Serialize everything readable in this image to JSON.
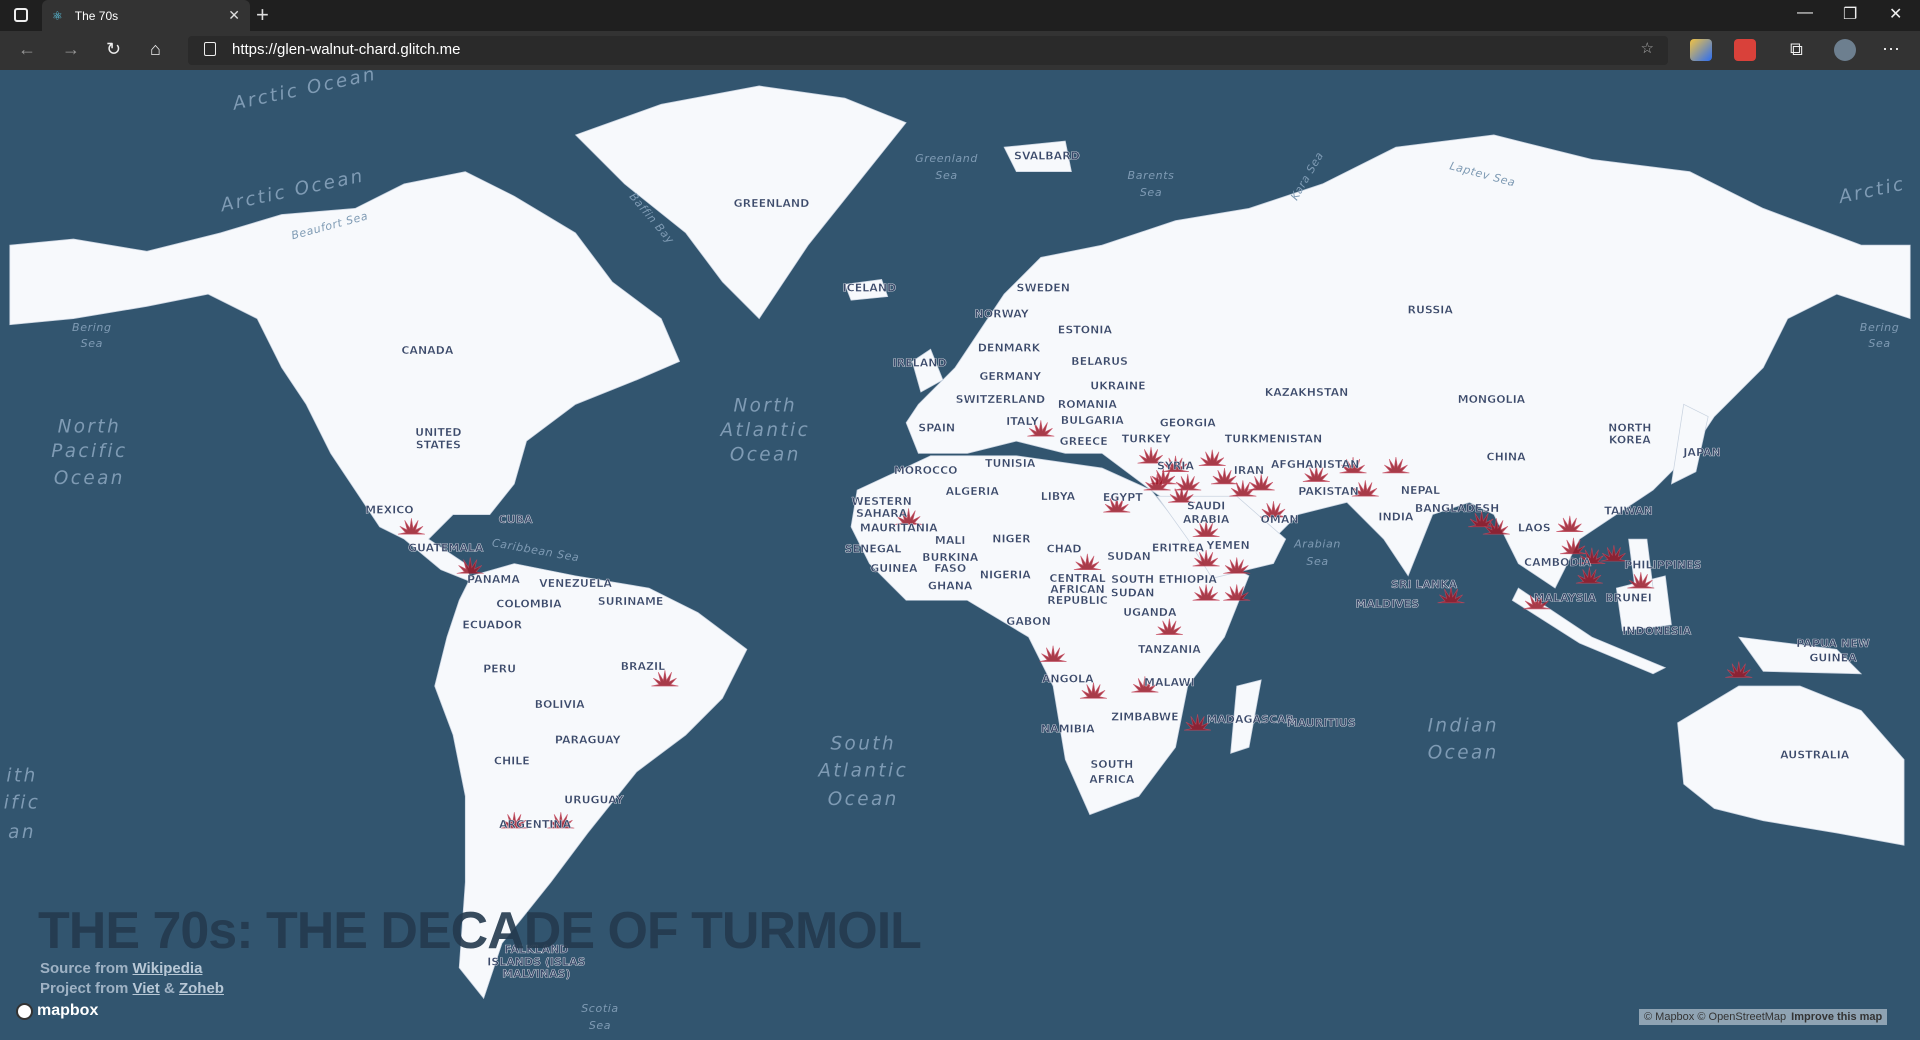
{
  "browser": {
    "tab_title": "The 70s",
    "url": "https://glen-walnut-chard.glitch.me",
    "icons": [
      "sidebar-icon",
      "react-favicon",
      "close-icon",
      "plus-icon",
      "back-icon",
      "forward-icon",
      "refresh-icon",
      "home-icon",
      "lock-icon",
      "favorite-add-icon",
      "extension-icon",
      "extension-icon-2",
      "collections-icon",
      "profile-avatar",
      "more-icon",
      "minimize-icon",
      "restore-icon",
      "window-close-icon"
    ]
  },
  "page": {
    "title": "THE 70s: THE DECADE OF TURMOIL",
    "source_prefix": "Source from ",
    "source_link": "Wikipedia",
    "project_prefix": "Project from ",
    "project_link1": "Viet",
    "project_amp": " & ",
    "project_link2": "Zoheb"
  },
  "map": {
    "colors": {
      "water": "#32556f",
      "land": "#f7f9fc",
      "marker": "#9b1b2a",
      "country_label": "#3b4a6b",
      "ocean_label": "#7f9bb4"
    },
    "oceans": [
      "Arctic Ocean",
      "Arctic Ocean",
      "Arctic",
      "North",
      "Pacific",
      "Ocean",
      "North",
      "Atlantic",
      "Ocean",
      "South",
      "Atlantic",
      "Ocean",
      "Indian",
      "Ocean",
      "ith",
      "ific",
      "an",
      "Greenland",
      "Sea",
      "Barents",
      "Sea",
      "Laptev Sea",
      "Bering",
      "Sea",
      "Bering",
      "Sea",
      "Arabian",
      "Sea",
      "Caribbean Sea",
      "Beaufort Sea",
      "Baffin Bay",
      "Kara Sea",
      "Scotia",
      "Sea"
    ],
    "countries": [
      "GREENLAND",
      "ICELAND",
      "SVALBARD",
      "CANADA",
      "UNITED",
      "STATES",
      "MEXICO",
      "CUBA",
      "GUATEMALA",
      "PANAMA",
      "VENEZUELA",
      "SURINAME",
      "COLOMBIA",
      "ECUADOR",
      "PERU",
      "BRAZIL",
      "BOLIVIA",
      "PARAGUAY",
      "CHILE",
      "URUGUAY",
      "ARGENTINA",
      "FALKLAND",
      "ISLANDS (ISLAS",
      "MALVINAS)",
      "SWEDEN",
      "NORWAY",
      "ESTONIA",
      "DENMARK",
      "IRELAND",
      "GERMANY",
      "BELARUS",
      "UKRAINE",
      "SWITZERLAND",
      "ROMANIA",
      "BULGARIA",
      "SPAIN",
      "ITALY",
      "GREECE",
      "TURKEY",
      "GEORGIA",
      "MOROCCO",
      "TUNISIA",
      "ALGERIA",
      "LIBYA",
      "EGYPT",
      "WESTERN",
      "SAHARA",
      "MAURITANIA",
      "MALI",
      "NIGER",
      "SENEGAL",
      "GUINEA",
      "BURKINA",
      "FASO",
      "GHANA",
      "NIGERIA",
      "CHAD",
      "SUDAN",
      "SOUTH",
      "SUDAN",
      "CENTRAL",
      "AFRICAN",
      "REPUBLIC",
      "ERITREA",
      "ETHIOPIA",
      "UGANDA",
      "GABON",
      "TANZANIA",
      "ANGOLA",
      "MALAWI",
      "ZIMBABWE",
      "NAMIBIA",
      "SOUTH",
      "AFRICA",
      "MADAGASCAR",
      "MAURITIUS",
      "RUSSIA",
      "KAZAKHSTAN",
      "MONGOLIA",
      "TURKMENISTAN",
      "AFGHANISTAN",
      "IRAN",
      "SYRIA",
      "SAUDI",
      "ARABIA",
      "YEMEN",
      "OMAN",
      "PAKISTAN",
      "NEPAL",
      "INDIA",
      "BANGLADESH",
      "SRI LANKA",
      "MALDIVES",
      "CHINA",
      "NORTH",
      "KOREA",
      "JAPAN",
      "TAIWAN",
      "LAOS",
      "CAMBODIA",
      "PHILIPPINES",
      "MALAYSIA",
      "BRUNEI",
      "INDONESIA",
      "PAPUA NEW",
      "GUINEA",
      "AUSTRALIA"
    ]
  },
  "attribution": {
    "text": "© Mapbox © OpenStreetMap",
    "improve": "Improve this map",
    "logo": "mapbox"
  }
}
